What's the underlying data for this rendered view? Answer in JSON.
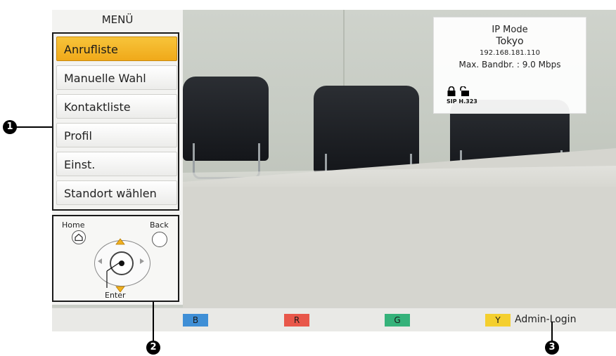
{
  "menu": {
    "title": "MENÜ",
    "items": [
      {
        "label": "Anrufliste",
        "active": true
      },
      {
        "label": "Manuelle Wahl"
      },
      {
        "label": "Kontaktliste"
      },
      {
        "label": "Profil"
      },
      {
        "label": "Einst."
      },
      {
        "label": "Standort wählen"
      }
    ]
  },
  "remote": {
    "home_label": "Home",
    "back_label": "Back",
    "enter_label": "Enter"
  },
  "info": {
    "mode": "IP Mode",
    "location": "Tokyo",
    "ip": "192.168.181.110",
    "bandwidth": "Max. Bandbr. : 9.0 Mbps",
    "protocols": "SIP H.323"
  },
  "bottom_bar": {
    "keys": [
      {
        "label": "B",
        "color": "#3f8fd6"
      },
      {
        "label": "R",
        "color": "#e8574a"
      },
      {
        "label": "G",
        "color": "#35b27a"
      },
      {
        "label": "Y",
        "color": "#f4cf2e"
      }
    ],
    "admin_label": "Admin-Login"
  },
  "callouts": [
    "1",
    "2",
    "3"
  ]
}
